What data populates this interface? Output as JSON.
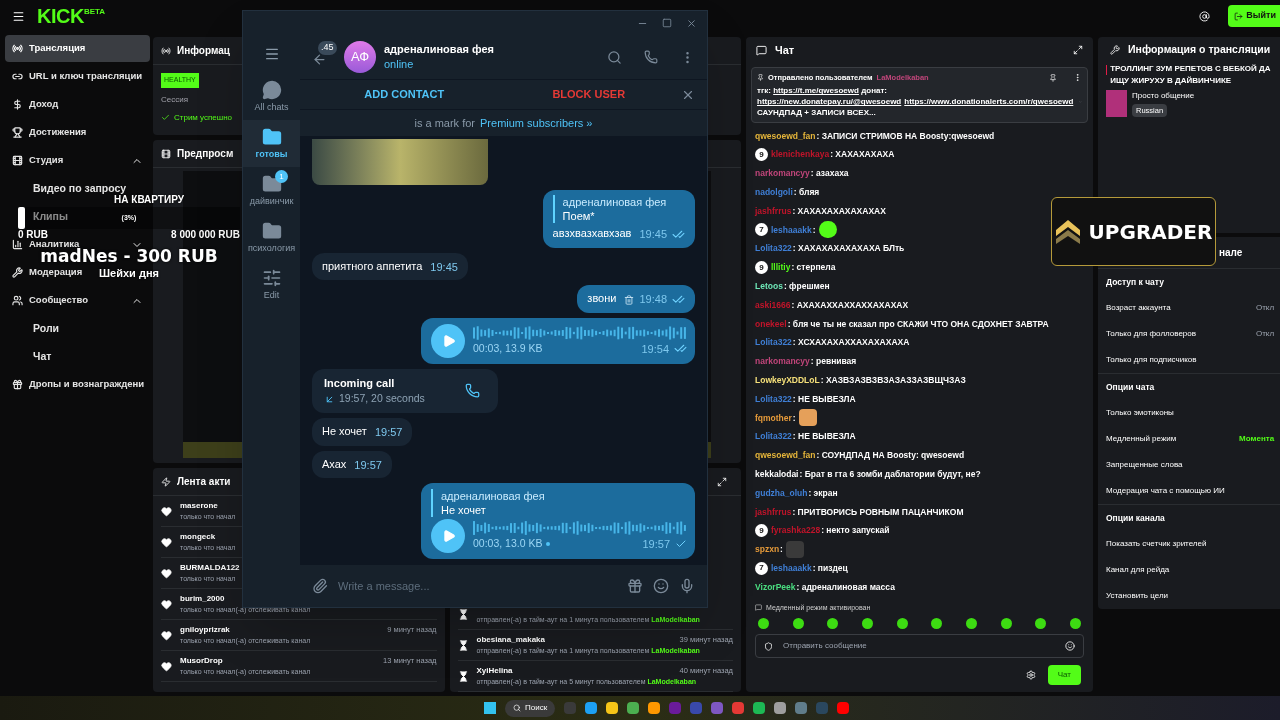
{
  "topbar": {
    "logo": "KICK",
    "logo_badge": "BETA",
    "exit_button": "Выйти"
  },
  "sidebar": {
    "items": [
      {
        "label": "Трансляция",
        "selected": true
      },
      {
        "label": "URL и ключ трансляции",
        "selected": false
      },
      {
        "label": "Доход",
        "selected": false
      },
      {
        "label": "Достижения",
        "selected": false
      },
      {
        "label": "Студия",
        "selected": false,
        "expanded": true,
        "children": [
          {
            "label": "Видео по запросу",
            "selected": false
          },
          {
            "label": "Клипы",
            "selected": false
          }
        ]
      },
      {
        "label": "Аналитика",
        "selected": false,
        "expanded": false
      },
      {
        "label": "Модерация",
        "selected": false
      },
      {
        "label": "Сообщество",
        "selected": false,
        "expanded": true,
        "children": [
          {
            "label": "Роли",
            "selected": false
          },
          {
            "label": "Чат",
            "selected": false
          }
        ]
      },
      {
        "label": "Дропы и вознаграждени",
        "selected": false
      }
    ]
  },
  "stream_overlay": {
    "goal_title": "НА КВАРТИРУ",
    "goal_percent": "(3%)",
    "level": 0.03,
    "goal_start": "0 RUB",
    "goal_end": "8 000 000 RUB",
    "donation": "madNes - 300 RUB",
    "caption": "Шейхи дня"
  },
  "info_panel": {
    "title": "Информац",
    "health": "HEALTHY",
    "session_label": "Сессия",
    "status": "Стрим успешно"
  },
  "preview_panel": {
    "title": "Предпросм"
  },
  "activity_feed": {
    "title": "Лента акти",
    "follows": [
      {
        "user": "maserone",
        "text": "только что начал"
      },
      {
        "user": "mongeck",
        "text": "только что начал"
      },
      {
        "user": "BURMALDA122",
        "text": "только что начал"
      },
      {
        "user": "burim_2000",
        "text": "только что начал(-а) отслеживать канал"
      },
      {
        "user": "gniloyprizrak",
        "text": "только что начал(-а) отслеживать канал",
        "time": "9 минут назад"
      },
      {
        "user": "MusorDrop",
        "text": "только что начал(-а) отслеживать канал",
        "time": "13 минут назад"
      }
    ],
    "timeouts": [
      {
        "text": "отправлен(-а) в тайм-аут на 1 минута пользователем",
        "moderator": "LaModelkaban"
      },
      {
        "user": "obesiana_makaka",
        "text": "отправлен(-а) в тайм-аут на 1 минута пользователем",
        "moderator": "LaModelkaban",
        "time": "39 минут назад"
      },
      {
        "user": "XyiHelina",
        "text": "отправлен(-а) в тайм-аут на 5 минут пользователем",
        "moderator": "LaModelkaban",
        "time": "40 минут назад"
      }
    ]
  },
  "chat": {
    "title": "Чат",
    "pinned": {
      "label": "Отправлено пользователем",
      "user": "LaModelkaban",
      "parts": [
        {
          "kind": "text",
          "text": "тгк: "
        },
        {
          "kind": "link",
          "text": "https://t.me/qwesoewd"
        },
        {
          "kind": "text",
          "text": " донат: "
        },
        {
          "kind": "link",
          "text": "https://new.donatepay.ru/@qwesoewd"
        },
        {
          "kind": "link",
          "text": "https://www.donationalerts.com/r/qwesoewd"
        },
        {
          "kind": "text",
          "text": " САУНДПАД + ЗАПИСИ ВСЕХ..."
        }
      ]
    },
    "messages": [
      {
        "kind": "text",
        "user": "qwesoewd_fan",
        "color": "#e5b53a",
        "text": ": ЗАПИСИ СТРИМОВ НА Boosty:qwesoewd"
      },
      {
        "kind": "text",
        "user": "klenichenkaya",
        "color": "#c0142a",
        "badge": "9",
        "text": ": ХАХАХАХАХА"
      },
      {
        "kind": "text",
        "user": "narkomancyy",
        "color": "#c0457a",
        "text": ": азахаха"
      },
      {
        "kind": "text",
        "user": "nadolgoli",
        "color": "#3f7fd6",
        "text": ": бляя"
      },
      {
        "kind": "text",
        "user": "jashfrrus",
        "color": "#c0142a",
        "text": ": ХАХАХАХАХАХАХАХ"
      },
      {
        "kind": "emote",
        "user": "leshaaakk",
        "color": "#3f7fd6",
        "badge": "7",
        "text": ":"
      },
      {
        "kind": "text",
        "user": "Lolita322",
        "color": "#3f7fd6",
        "text": ": ХАХАХАХАХАХАХА БЛть"
      },
      {
        "kind": "text",
        "user": "lllitiy",
        "color": "#53fc18",
        "badge": "9",
        "text": ": стерпела"
      },
      {
        "kind": "text",
        "user": "Letoos",
        "color": "#6ee7b7",
        "text": ": фрешмен"
      },
      {
        "kind": "text",
        "user": "aski1666",
        "color": "#c0142a",
        "text": ": АХАХАХХАХХАХХАХАХАХ"
      },
      {
        "kind": "text",
        "user": "onekeel",
        "color": "#c0142a",
        "text": ": бля че ты не сказал про СКАЖИ ЧТО ОНА СДОХНЕТ ЗАВТРА"
      },
      {
        "kind": "text",
        "user": "Lolita322",
        "color": "#3f7fd6",
        "text": ": ХСХАХАХАХХАХАХАХАХА"
      },
      {
        "kind": "text",
        "user": "narkomancyy",
        "color": "#c0457a",
        "text": ": ревнивая"
      },
      {
        "kind": "text",
        "user": "LowkeyXDDLoL",
        "color": "#f5e07a",
        "text": ": ХАЗВЗАЗВЗВЗАЗАЗЗАЗВЩЧЗАЗ"
      },
      {
        "kind": "text",
        "user": "Lolita322",
        "color": "#3f7fd6",
        "text": ": НЕ ВЫВЕЗЛА"
      },
      {
        "kind": "sticker",
        "user": "fqmother",
        "color": "#e59a3a",
        "text": ":"
      },
      {
        "kind": "text",
        "user": "Lolita322",
        "color": "#3f7fd6",
        "text": ": НЕ ВЫВЕЗЛА"
      },
      {
        "kind": "text",
        "user": "qwesoewd_fan",
        "color": "#e5b53a",
        "text": ": СОУНДПАД НА Boosty: qwesoewd"
      },
      {
        "kind": "text",
        "user": "kekkalodai",
        "color": "#ffffff",
        "text": ": Брат в гта 6 зомби даблатории будут, не?"
      },
      {
        "kind": "text",
        "user": "gudzha_oluh",
        "color": "#3f7fd6",
        "text": ": экран"
      },
      {
        "kind": "text",
        "user": "jashfrrus",
        "color": "#c0142a",
        "text": ": ПРИТВОРИСЬ РОВНЫМ ПАЦАНЧИКОМ"
      },
      {
        "kind": "text",
        "user": "fyrashka228",
        "color": "#c0142a",
        "badge": "9",
        "text": ": некто запускай"
      },
      {
        "kind": "image",
        "user": "spzxn",
        "color": "#e59a3a",
        "text": ":"
      },
      {
        "kind": "text",
        "user": "leshaaakk",
        "color": "#3f7fd6",
        "badge": "7",
        "text": ": пиздец"
      },
      {
        "kind": "text",
        "user": "VizorPeek",
        "color": "#4ade80",
        "text": ": адреналиновая масса"
      }
    ],
    "slow_mode_note": "Медленный режим активирован",
    "input_placeholder": "Отправить сообщение",
    "send_button": "Чат"
  },
  "stream_info": {
    "title": "Информация о трансляции",
    "stream_title": "ТРОЛЛИНГ ЗУМ РЕПЕТОВ С ВЕБКОЙ ДА ИЩУ ЖИРУХУ В ДАЙВИНЧИКЕ",
    "category": "Просто общение",
    "tag": "Russian"
  },
  "channel_settings": {
    "title": "нале",
    "sections": [
      {
        "title": "Доступ к чату",
        "rows": [
          {
            "label": "Возраст аккаунта",
            "value": "Откл",
            "active": false
          },
          {
            "label": "Только для фолловеров",
            "value": "Откл",
            "active": false
          },
          {
            "label": "Только для подписчиков"
          }
        ]
      },
      {
        "title": "Опции чата",
        "rows": [
          {
            "label": "Только эмотиконы"
          },
          {
            "label": "Медленный режим",
            "value": "Момента",
            "active": true
          },
          {
            "label": "Запрещенные слова"
          },
          {
            "label": "Модерация чата с помощью ИИ"
          }
        ]
      },
      {
        "title": "Опции канала",
        "rows": [
          {
            "label": "Показать счетчик зрителей"
          },
          {
            "label": "Канал для рейда"
          },
          {
            "label": "Установить цели"
          }
        ]
      }
    ]
  },
  "ad_overlay": {
    "text": "UPGRADER"
  },
  "telegram": {
    "folders": [
      {
        "label": "All chats",
        "selected": false
      },
      {
        "label": "готовы",
        "selected": true
      },
      {
        "label": "дайвинчик",
        "selected": false,
        "badge": "1"
      },
      {
        "label": "психология",
        "selected": false
      },
      {
        "label": "Edit",
        "selected": false
      }
    ],
    "back_count": ".45",
    "avatar": "АФ",
    "name": "адреналиновая фея",
    "status": "online",
    "add_contact": "ADD CONTACT",
    "block_user": "BLOCK USER",
    "premium_note": "is a mark for",
    "premium_link": "Premium subscribers »",
    "messages": [
      {
        "kind": "photo"
      },
      {
        "kind": "text",
        "out": true,
        "reply": {
          "name": "адреналиновая фея",
          "text": "Поем*"
        },
        "text": "авзхвазхавхзав",
        "time": "19:45",
        "read": true
      },
      {
        "kind": "text",
        "out": false,
        "text": "приятного аппетита",
        "time": "19:45"
      },
      {
        "kind": "text",
        "out": true,
        "text": "звони",
        "time": "19:48",
        "read": true,
        "trash": true
      },
      {
        "kind": "voice",
        "out": true,
        "meta": "00:03, 13.9 KB",
        "time": "19:54",
        "read": true,
        "unplayed": false
      },
      {
        "kind": "call",
        "out": false,
        "title": "Incoming call",
        "text": "19:57, 20 seconds"
      },
      {
        "kind": "text",
        "out": false,
        "text": "Не хочет",
        "time": "19:57"
      },
      {
        "kind": "text",
        "out": false,
        "text": "Ахах",
        "time": "19:57"
      },
      {
        "kind": "voice",
        "out": true,
        "reply": {
          "name": "адреналиновая фея",
          "text": "Не хочет"
        },
        "meta": "00:03, 13.0 KB",
        "time": "19:57",
        "read": false,
        "unplayed": true
      }
    ],
    "composer_placeholder": "Write a message..."
  },
  "taskbar": {
    "search": "Поиск"
  }
}
